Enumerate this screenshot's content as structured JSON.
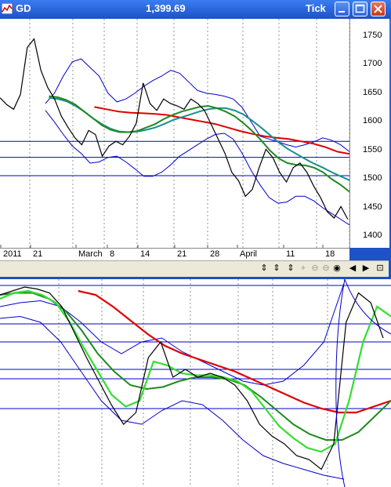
{
  "window": {
    "symbol": "GD",
    "price": "1,399.69",
    "mode": "Tick"
  },
  "upper_chart": {
    "y_ticks": [
      "1750",
      "1700",
      "1650",
      "1600",
      "1550",
      "1500",
      "1450",
      "1400"
    ],
    "x_ticks": [
      "2011",
      "21",
      "March",
      "8",
      "14",
      "21",
      "28",
      "April",
      "11",
      "18"
    ]
  },
  "toolbar": {
    "icons": [
      "scroll-left-right-icon",
      "navigate-icon",
      "zoom-icon",
      "crosshair-icon",
      "zoom-out-icon",
      "zoom-reset-icon",
      "play-back-icon",
      "play-forward-icon",
      "scroll-end-icon"
    ]
  },
  "colors": {
    "price": "#000000",
    "band": "#0000cc",
    "level": "#0000cc",
    "ma_fast": "#1f8a1f",
    "ma_mid": "#1a8f8f",
    "ma_slow": "#e00000",
    "ma_light": "#33dd33",
    "grid": "#666666"
  },
  "chart_data": [
    {
      "type": "line",
      "title": "",
      "ylim": [
        1380,
        1780
      ],
      "y_ticks": [
        1750,
        1700,
        1650,
        1600,
        1550,
        1500,
        1450,
        1400
      ],
      "levels": [
        1566,
        1538,
        1506
      ],
      "series": [
        {
          "role": "price",
          "values": [
            1642,
            1630,
            1622,
            1648,
            1730,
            1745,
            1690,
            1660,
            1640,
            1610,
            1590,
            1572,
            1560,
            1585,
            1578,
            1540,
            1558,
            1566,
            1560,
            1575,
            1598,
            1668,
            1632,
            1620,
            1640,
            1632,
            1628,
            1622,
            1640,
            1632,
            1620,
            1595,
            1570,
            1545,
            1512,
            1497,
            1470,
            1482,
            1520,
            1552,
            1538,
            1512,
            1495,
            1520,
            1528,
            1512,
            1488,
            1468,
            1443,
            1432,
            1452,
            1430
          ]
        },
        {
          "role": "ma_fast",
          "values": [
            1645,
            1643,
            1638,
            1630,
            1618,
            1606,
            1594,
            1586,
            1582,
            1582,
            1584,
            1590,
            1596,
            1605,
            1612,
            1618,
            1622,
            1626,
            1628,
            1624,
            1618,
            1610,
            1598,
            1584,
            1568,
            1550,
            1536,
            1528,
            1525,
            1524,
            1520,
            1512,
            1500,
            1490,
            1478
          ]
        },
        {
          "role": "ma_mid",
          "values": [
            1642,
            1640,
            1636,
            1628,
            1618,
            1606,
            1596,
            1588,
            1583,
            1582,
            1583,
            1586,
            1590,
            1596,
            1603,
            1608,
            1613,
            1618,
            1622,
            1624,
            1624,
            1620,
            1613,
            1602,
            1590,
            1577,
            1564,
            1553,
            1544,
            1535,
            1527,
            1520,
            1512,
            1505,
            1498
          ]
        },
        {
          "role": "ma_slow",
          "values": [
            1626,
            1622,
            1618,
            1616,
            1615,
            1614,
            1612,
            1608,
            1604,
            1600,
            1596,
            1590,
            1584,
            1579,
            1575,
            1572,
            1570,
            1566,
            1562,
            1556,
            1548,
            1544
          ]
        },
        {
          "role": "band_upper",
          "values": [
            1632,
            1650,
            1680,
            1705,
            1710,
            1695,
            1680,
            1650,
            1635,
            1640,
            1650,
            1662,
            1672,
            1680,
            1690,
            1685,
            1670,
            1655,
            1650,
            1648,
            1645,
            1640,
            1625,
            1600,
            1575,
            1570,
            1565,
            1560,
            1556,
            1560,
            1565,
            1572,
            1568,
            1560,
            1548
          ]
        },
        {
          "role": "band_lower",
          "values": [
            1620,
            1600,
            1578,
            1558,
            1545,
            1528,
            1530,
            1538,
            1540,
            1530,
            1518,
            1505,
            1505,
            1512,
            1525,
            1540,
            1550,
            1560,
            1570,
            1578,
            1580,
            1570,
            1545,
            1515,
            1490,
            1468,
            1458,
            1460,
            1470,
            1470,
            1462,
            1450,
            1440,
            1430,
            1420
          ]
        }
      ]
    },
    {
      "type": "line",
      "title": "",
      "series": [
        {
          "role": "price",
          "values": [
            0.06,
            0.04,
            0.02,
            0.03,
            0.05,
            0.12,
            0.25,
            0.38,
            0.5,
            0.62,
            0.72,
            0.66,
            0.38,
            0.3,
            0.48,
            0.44,
            0.48,
            0.46,
            0.48,
            0.52,
            0.6,
            0.72,
            0.78,
            0.82,
            0.88,
            0.9,
            0.95,
            0.82,
            0.2,
            0.05,
            0.1,
            0.28
          ]
        },
        {
          "role": "ma_light",
          "values": [
            0.08,
            0.05,
            0.04,
            0.06,
            0.1,
            0.2,
            0.33,
            0.45,
            0.57,
            0.63,
            0.6,
            0.4,
            0.42,
            0.46,
            0.47,
            0.47,
            0.48,
            0.5,
            0.55,
            0.64,
            0.73,
            0.79,
            0.84,
            0.86,
            0.82,
            0.6,
            0.3,
            0.12,
            0.17
          ]
        },
        {
          "role": "ma_fast",
          "values": [
            0.06,
            0.05,
            0.05,
            0.08,
            0.14,
            0.24,
            0.36,
            0.45,
            0.52,
            0.54,
            0.53,
            0.5,
            0.48,
            0.48,
            0.49,
            0.52,
            0.58,
            0.65,
            0.72,
            0.77,
            0.8,
            0.8,
            0.76,
            0.68,
            0.6
          ]
        },
        {
          "role": "ma_slow",
          "values": [
            0.04,
            0.06,
            0.12,
            0.19,
            0.26,
            0.32,
            0.36,
            0.39,
            0.42,
            0.45,
            0.49,
            0.53,
            0.57,
            0.61,
            0.64,
            0.66,
            0.66,
            0.63,
            0.6
          ]
        },
        {
          "role": "band_upper",
          "values": [
            0.12,
            0.1,
            0.09,
            0.12,
            0.2,
            0.3,
            0.36,
            0.3,
            0.28,
            0.35,
            0.4,
            0.45,
            0.5,
            0.52,
            0.5,
            0.42,
            0.3,
            0.0
          ]
        },
        {
          "role": "band_lower",
          "values": [
            0.18,
            0.17,
            0.2,
            0.3,
            0.45,
            0.6,
            0.7,
            0.72,
            0.65,
            0.6,
            0.62,
            0.7,
            0.8,
            0.88,
            0.92,
            0.95,
            0.98,
            1.0
          ]
        }
      ]
    }
  ]
}
